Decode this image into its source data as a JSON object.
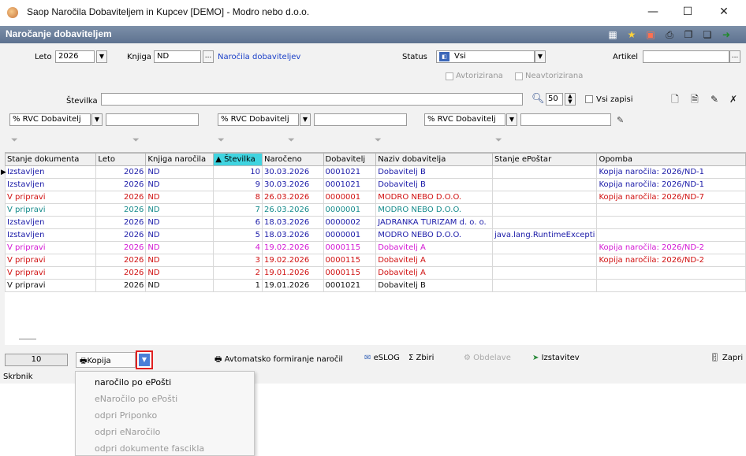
{
  "window": {
    "title": "Saop  Naročila Dobaviteljem in Kupcev [DEMO] - Modro nebo d.o.o.",
    "minimize": "—",
    "maximize": "☐",
    "close": "✕"
  },
  "header": {
    "title": "Naročanje dobaviteljem"
  },
  "filters": {
    "leto_label": "Leto",
    "leto_value": "2026",
    "knjiga_label": "Knjiga",
    "knjiga_value": "ND",
    "knjiga_link": "Naročila dobaviteljev",
    "status_label": "Status",
    "status_value": "Vsi",
    "artikel_label": "Artikel",
    "artikel_value": "",
    "avtorizirana": "Avtorizirana",
    "neavtorizirana": "Neavtorizirana",
    "stevilka_label": "Številka",
    "stevilka_value": "",
    "limit_value": "50",
    "vsi_zapisi": "Vsi zapisi",
    "rvc1": "% RVC Dobavitelj",
    "rvc2": "% RVC Dobavitelj",
    "rvc3": "% RVC Dobavitelj"
  },
  "grid": {
    "columns": [
      "Stanje dokumenta",
      "Leto",
      "Knjiga naročila",
      "Številka",
      "Naročeno",
      "Dobavitelj",
      "Naziv dobavitelja",
      "Stanje ePoštar",
      "Opomba"
    ],
    "rows": [
      {
        "stanje": "Izstavljen",
        "leto": "2026",
        "knjiga": "ND",
        "stevilka": "10",
        "naroceno": "30.03.2026",
        "dobavitelj": "0001021",
        "naziv": "Dobavitelj B",
        "eposta": "",
        "opomba": "Kopija naročila: 2026/ND-1",
        "color": "#1a1aa8"
      },
      {
        "stanje": "Izstavljen",
        "leto": "2026",
        "knjiga": "ND",
        "stevilka": "9",
        "naroceno": "30.03.2026",
        "dobavitelj": "0001021",
        "naziv": "Dobavitelj B",
        "eposta": "",
        "opomba": "Kopija naročila: 2026/ND-1",
        "color": "#1a1aa8"
      },
      {
        "stanje": "V pripravi",
        "leto": "2026",
        "knjiga": "ND",
        "stevilka": "8",
        "naroceno": "26.03.2026",
        "dobavitelj": "0000001",
        "naziv": "MODRO NEBO D.O.O.",
        "eposta": "",
        "opomba": "Kopija naročila: 2026/ND-7",
        "color": "#d01010"
      },
      {
        "stanje": "V pripravi",
        "leto": "2026",
        "knjiga": "ND",
        "stevilka": "7",
        "naroceno": "26.03.2026",
        "dobavitelj": "0000001",
        "naziv": "MODRO NEBO D.O.O.",
        "eposta": "",
        "opomba": "",
        "color": "#148a8a"
      },
      {
        "stanje": "Izstavljen",
        "leto": "2026",
        "knjiga": "ND",
        "stevilka": "6",
        "naroceno": "18.03.2026",
        "dobavitelj": "0000002",
        "naziv": "JADRANKA TURIZAM d. o. o.",
        "eposta": "",
        "opomba": "",
        "color": "#1a1aa8"
      },
      {
        "stanje": "Izstavljen",
        "leto": "2026",
        "knjiga": "ND",
        "stevilka": "5",
        "naroceno": "18.03.2026",
        "dobavitelj": "0000001",
        "naziv": "MODRO NEBO D.O.O.",
        "eposta": "java.lang.RuntimeExcepti",
        "opomba": "",
        "color": "#1a1aa8"
      },
      {
        "stanje": "V pripravi",
        "leto": "2026",
        "knjiga": "ND",
        "stevilka": "4",
        "naroceno": "19.02.2026",
        "dobavitelj": "0000115",
        "naziv": "Dobavitelj A",
        "eposta": "",
        "opomba": "Kopija naročila: 2026/ND-2",
        "color": "#d418d4"
      },
      {
        "stanje": "V pripravi",
        "leto": "2026",
        "knjiga": "ND",
        "stevilka": "3",
        "naroceno": "19.02.2026",
        "dobavitelj": "0000115",
        "naziv": "Dobavitelj A",
        "eposta": "",
        "opomba": "Kopija naročila: 2026/ND-2",
        "color": "#d01010"
      },
      {
        "stanje": "V pripravi",
        "leto": "2026",
        "knjiga": "ND",
        "stevilka": "2",
        "naroceno": "19.01.2026",
        "dobavitelj": "0000115",
        "naziv": "Dobavitelj A",
        "eposta": "",
        "opomba": "",
        "color": "#d01010"
      },
      {
        "stanje": "V pripravi",
        "leto": "2026",
        "knjiga": "ND",
        "stevilka": "1",
        "naroceno": "19.01.2026",
        "dobavitelj": "0001021",
        "naziv": "Dobavitelj B",
        "eposta": "",
        "opomba": "",
        "color": "#111111"
      }
    ]
  },
  "bottom": {
    "count": "10",
    "kopija": "Kopija",
    "avtomatsko": "Avtomatsko formiranje naročil",
    "eslog": "eSLOG",
    "zbiri": "Zbiri",
    "obdelave": "Obdelave",
    "izstavitev": "Izstavitev",
    "zapri": "Zapri"
  },
  "status_bar": {
    "text": "Skrbnik"
  },
  "menu": {
    "items": [
      {
        "label": "naročilo po ePošti",
        "enabled": true
      },
      {
        "label": "eNaročilo po ePošti",
        "enabled": false
      },
      {
        "label": "odpri Priponko",
        "enabled": false
      },
      {
        "label": "odpri eNaročilo",
        "enabled": false
      },
      {
        "label": "odpri dokumente fascikla",
        "enabled": false
      }
    ]
  }
}
